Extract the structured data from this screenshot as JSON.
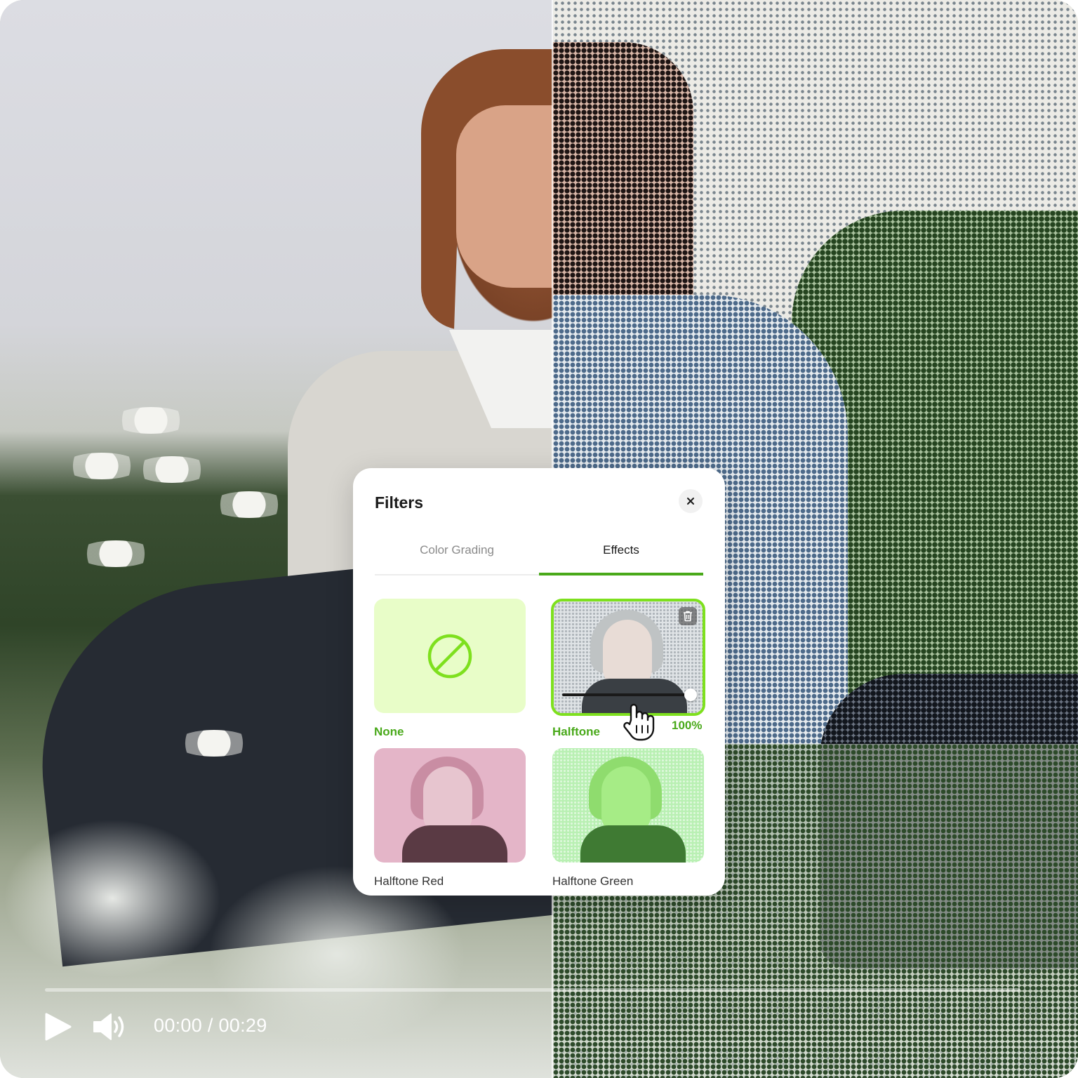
{
  "player": {
    "current_time": "00:00",
    "separator": " / ",
    "duration": "00:29",
    "play_icon": "play-icon",
    "volume_icon": "volume-icon",
    "progress": 0
  },
  "filters_panel": {
    "title": "Filters",
    "close_icon": "close-icon",
    "tabs": [
      {
        "label": "Color Grading",
        "active": false
      },
      {
        "label": "Effects",
        "active": true
      }
    ],
    "items": [
      {
        "label": "None",
        "selected": false,
        "icon": "no-filter-icon"
      },
      {
        "label": "Halftone",
        "selected": true,
        "intensity": "100%",
        "intensity_value": 100
      },
      {
        "label": "Halftone Red",
        "selected": false
      },
      {
        "label": "Halftone Green",
        "selected": false
      }
    ]
  },
  "colors": {
    "accent": "#49a91a",
    "accent_bright": "#7ee01e",
    "none_tile": "#e8fdc8"
  }
}
